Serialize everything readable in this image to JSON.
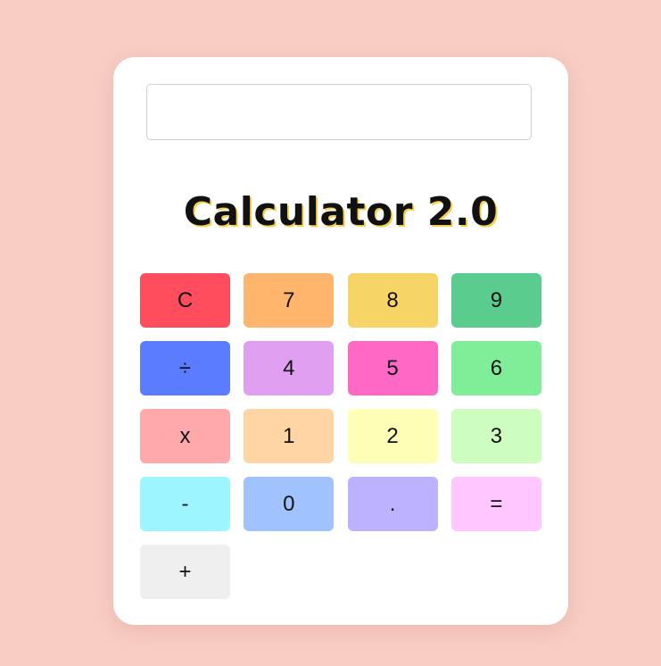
{
  "display": {
    "value": "",
    "placeholder": ""
  },
  "title": "Calculator 2.0",
  "keys": [
    {
      "label": "C",
      "name": "clear-button",
      "color": "#ff4d5e"
    },
    {
      "label": "7",
      "name": "digit-7-button",
      "color": "#ffb56b"
    },
    {
      "label": "8",
      "name": "digit-8-button",
      "color": "#f6d466"
    },
    {
      "label": "9",
      "name": "digit-9-button",
      "color": "#5acc8e"
    },
    {
      "label": "÷",
      "name": "divide-button",
      "color": "#5c7cff"
    },
    {
      "label": "4",
      "name": "digit-4-button",
      "color": "#e19ff2"
    },
    {
      "label": "5",
      "name": "digit-5-button",
      "color": "#ff69c6"
    },
    {
      "label": "6",
      "name": "digit-6-button",
      "color": "#80ed99"
    },
    {
      "label": "x",
      "name": "multiply-button",
      "color": "#ffa9ab"
    },
    {
      "label": "1",
      "name": "digit-1-button",
      "color": "#ffd5a3"
    },
    {
      "label": "2",
      "name": "digit-2-button",
      "color": "#fefeb7"
    },
    {
      "label": "3",
      "name": "digit-3-button",
      "color": "#cdfebf"
    },
    {
      "label": "-",
      "name": "subtract-button",
      "color": "#9df5ff"
    },
    {
      "label": "0",
      "name": "digit-0-button",
      "color": "#a0c3ff"
    },
    {
      "label": ".",
      "name": "decimal-button",
      "color": "#bdb2ff"
    },
    {
      "label": "=",
      "name": "equals-button",
      "color": "#ffc6ff"
    },
    {
      "label": "+",
      "name": "add-button",
      "color": "#efefef"
    }
  ]
}
